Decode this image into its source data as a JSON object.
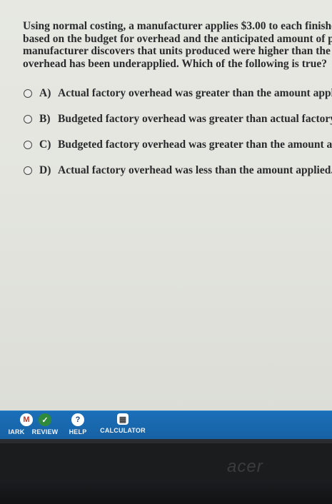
{
  "question": {
    "lines": [
      "Using normal costing, a manufacturer applies $3.00 to each finished u",
      "based on the budget for overhead and the anticipated amount of produ",
      "manufacturer discovers that units produced were higher than the numb",
      "overhead has been underapplied. Which of the following is true?"
    ]
  },
  "options": [
    {
      "letter": "A)",
      "text": "Actual factory overhead was greater than the amount applied."
    },
    {
      "letter": "B)",
      "text": "Budgeted factory overhead was greater than actual factory ov"
    },
    {
      "letter": "C)",
      "text": "Budgeted factory overhead was greater than the amount appli"
    },
    {
      "letter": "D)",
      "text": "Actual factory overhead was less than the amount applied."
    }
  ],
  "toolbar": {
    "mark": {
      "label": "IARK",
      "icon_glyph": "M"
    },
    "review": {
      "label": "REVIEW",
      "icon_glyph": "✓"
    },
    "help": {
      "label": "HELP",
      "icon_glyph": "?"
    },
    "calculator": {
      "label": "CALCULATOR",
      "icon_glyph": "▦"
    }
  },
  "monitor": {
    "brand": "acer"
  }
}
